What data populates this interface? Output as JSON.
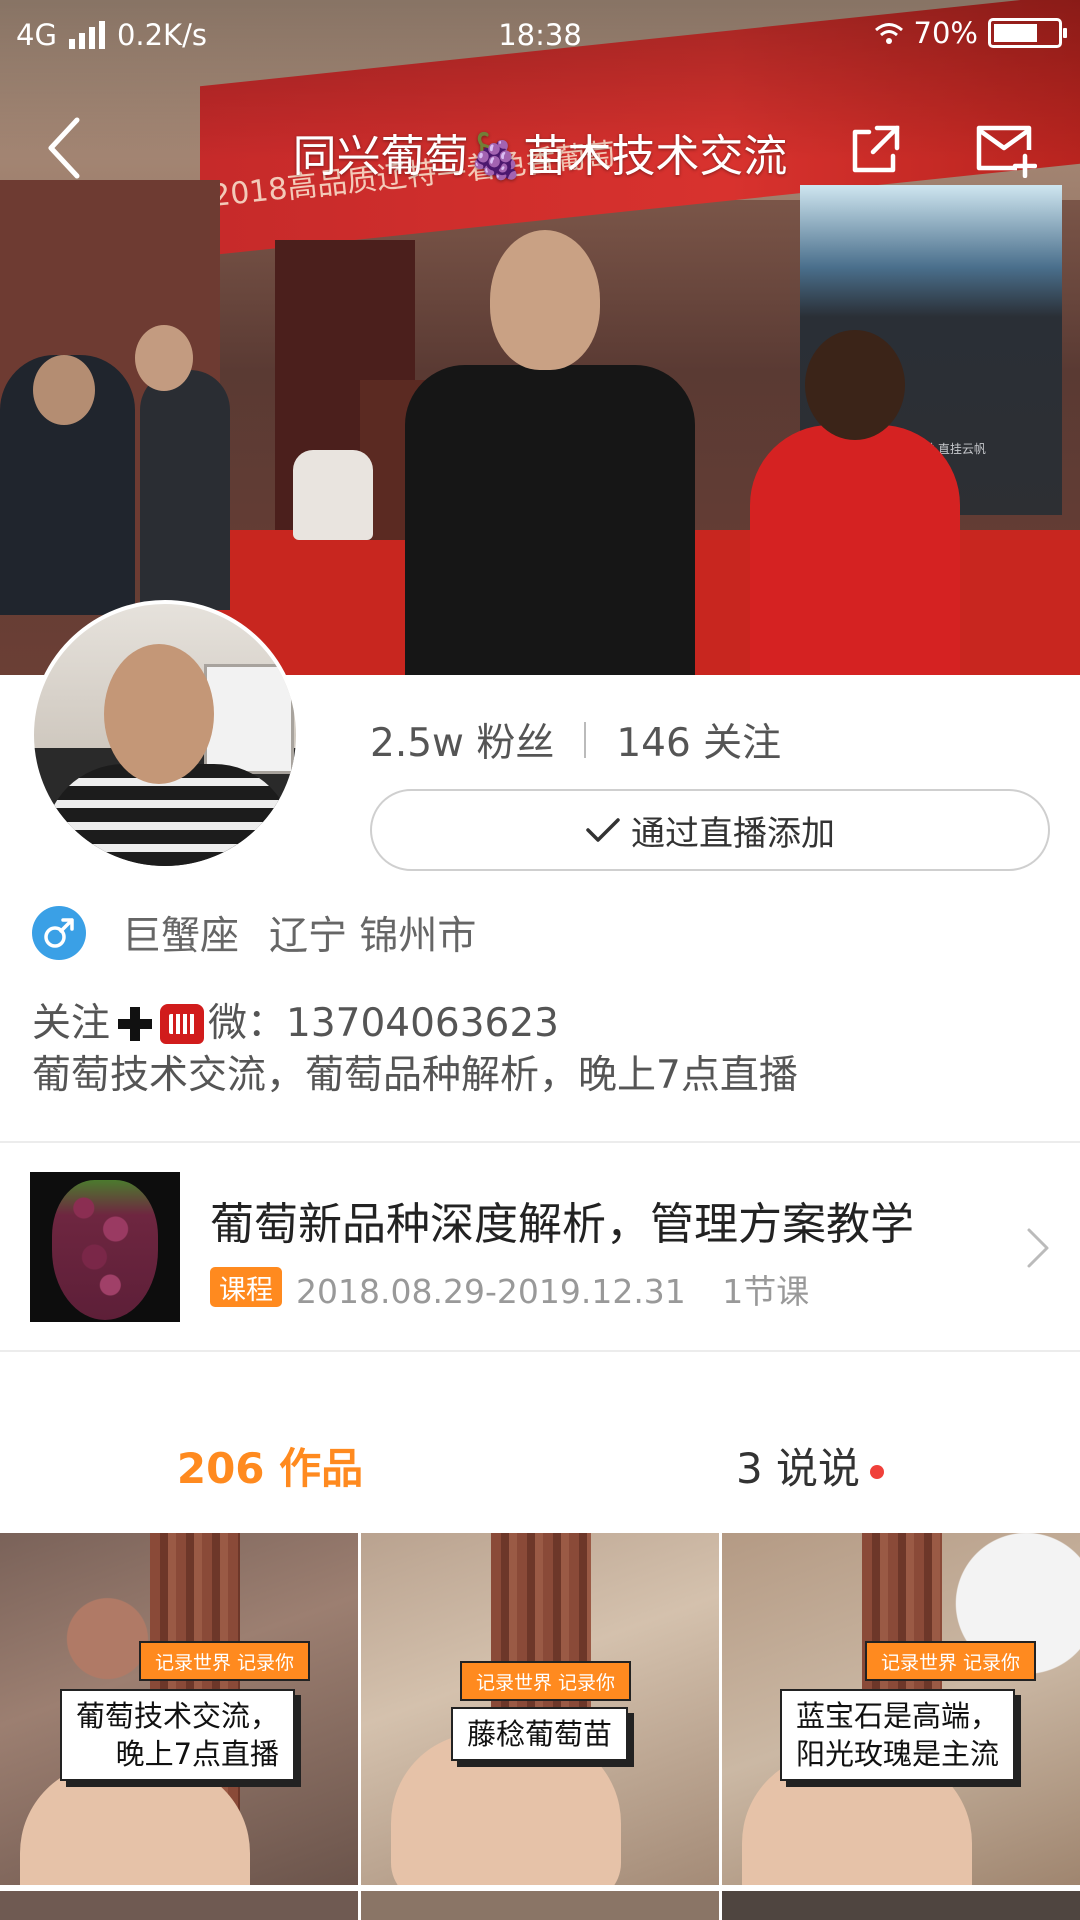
{
  "status_bar": {
    "network": "4G",
    "speed": "0.2K/s",
    "time": "18:38",
    "battery": "70%",
    "battery_level": 0.7
  },
  "nav": {
    "title": "同兴葡萄🍇苗木技术交流"
  },
  "cover": {
    "banner_text": "2018高品质辽特—着色香葡萄",
    "banner_sub": "主办单位",
    "screen_text": "风破浪会有时  直挂云帆"
  },
  "profile": {
    "followers": "2.5w 粉丝",
    "following": "146 关注",
    "action_button": "通过直播添加",
    "zodiac": "巨蟹座",
    "location": "辽宁 锦州市",
    "bio_prefix": "关注",
    "bio_contact": "微：13704063623",
    "bio_line2": "葡萄技术交流，葡萄品种解析，晚上7点直播"
  },
  "course": {
    "title": "葡萄新品种深度解析，管理方案教学",
    "tag": "课程",
    "dates": "2018.08.29-2019.12.31",
    "lessons": "1节课"
  },
  "tabs": {
    "works": "206 作品",
    "posts": "3 说说"
  },
  "videos": [
    {
      "tag": "记录世界 记录你",
      "line1": "葡萄技术交流，",
      "line2": "晚上7点直播"
    },
    {
      "tag": "记录世界 记录你",
      "line1": "藤稔葡萄苗",
      "line2": ""
    },
    {
      "tag": "记录世界 记录你",
      "line1": "蓝宝石是高端，",
      "line2": "阳光玫瑰是主流"
    }
  ],
  "colors": {
    "accent": "#ff8a1f",
    "gender_male": "#3aa0e6",
    "notify_dot": "#f0403a"
  }
}
